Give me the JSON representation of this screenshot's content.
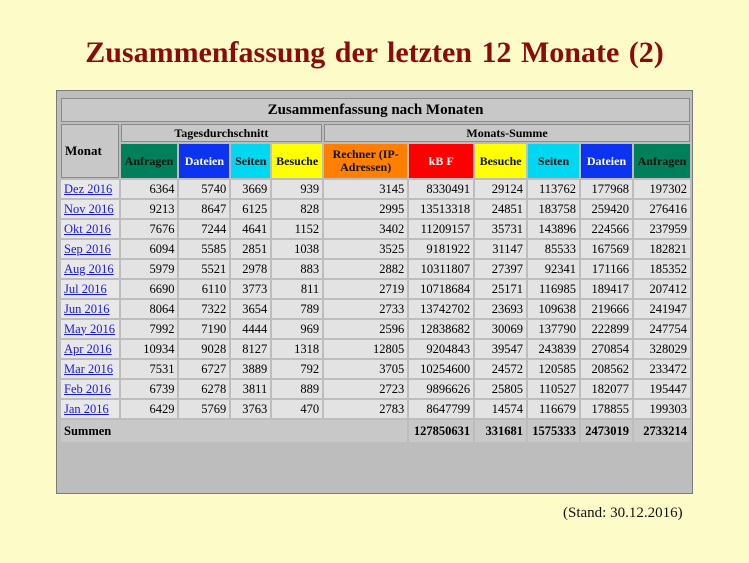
{
  "slide": {
    "title": "Zusammenfassung der letzten 12 Monate (2)",
    "footer_note": "(Stand: 30.12.2016)"
  },
  "table": {
    "caption": "Zusammenfassung nach Monaten",
    "month_header": "Monat",
    "group_daily": "Tagesdurchschnitt",
    "group_monthly": "Monats-Summe",
    "columns": {
      "anfragen_d": "Anfragen",
      "dateien_d": "Dateien",
      "seiten_d": "Seiten",
      "besuche_d": "Besuche",
      "rechner_m": "Rechner (IP-Adressen)",
      "kbf_m": "kB F",
      "besuche_m": "Besuche",
      "seiten_m": "Seiten",
      "dateien_m": "Dateien",
      "anfragen_m": "Anfragen"
    },
    "rows": [
      {
        "month": "Dez 2016",
        "v": [
          "6364",
          "5740",
          "3669",
          "939",
          "3145",
          "8330491",
          "29124",
          "113762",
          "177968",
          "197302"
        ]
      },
      {
        "month": "Nov 2016",
        "v": [
          "9213",
          "8647",
          "6125",
          "828",
          "2995",
          "13513318",
          "24851",
          "183758",
          "259420",
          "276416"
        ]
      },
      {
        "month": "Okt 2016",
        "v": [
          "7676",
          "7244",
          "4641",
          "1152",
          "3402",
          "11209157",
          "35731",
          "143896",
          "224566",
          "237959"
        ]
      },
      {
        "month": "Sep 2016",
        "v": [
          "6094",
          "5585",
          "2851",
          "1038",
          "3525",
          "9181922",
          "31147",
          "85533",
          "167569",
          "182821"
        ]
      },
      {
        "month": "Aug 2016",
        "v": [
          "5979",
          "5521",
          "2978",
          "883",
          "2882",
          "10311807",
          "27397",
          "92341",
          "171166",
          "185352"
        ]
      },
      {
        "month": "Jul 2016",
        "v": [
          "6690",
          "6110",
          "3773",
          "811",
          "2719",
          "10718684",
          "25171",
          "116985",
          "189417",
          "207412"
        ]
      },
      {
        "month": "Jun 2016",
        "v": [
          "8064",
          "7322",
          "3654",
          "789",
          "2733",
          "13742702",
          "23693",
          "109638",
          "219666",
          "241947"
        ]
      },
      {
        "month": "May 2016",
        "v": [
          "7992",
          "7190",
          "4444",
          "969",
          "2596",
          "12838682",
          "30069",
          "137790",
          "222899",
          "247754"
        ]
      },
      {
        "month": "Apr 2016",
        "v": [
          "10934",
          "9028",
          "8127",
          "1318",
          "12805",
          "9204843",
          "39547",
          "243839",
          "270854",
          "328029"
        ]
      },
      {
        "month": "Mar 2016",
        "v": [
          "7531",
          "6727",
          "3889",
          "792",
          "3705",
          "10254600",
          "24572",
          "120585",
          "208562",
          "233472"
        ]
      },
      {
        "month": "Feb 2016",
        "v": [
          "6739",
          "6278",
          "3811",
          "889",
          "2723",
          "9896626",
          "25805",
          "110527",
          "182077",
          "195447"
        ]
      },
      {
        "month": "Jan 2016",
        "v": [
          "6429",
          "5769",
          "3763",
          "470",
          "2783",
          "8647799",
          "14574",
          "116679",
          "178855",
          "199303"
        ]
      }
    ],
    "totals": {
      "label": "Summen",
      "kbf": "127850631",
      "besuche": "331681",
      "seiten": "1575333",
      "dateien": "2473019",
      "anfragen": "2733214"
    },
    "colors": {
      "anfragen": "#00805a",
      "dateien": "#0b33f0",
      "seiten": "#00d7f0",
      "besuche": "#ffff00",
      "rechner": "#ff8000",
      "kbf": "#ff0000",
      "title": "#8b0a0a",
      "background": "#fdfcc8"
    }
  }
}
